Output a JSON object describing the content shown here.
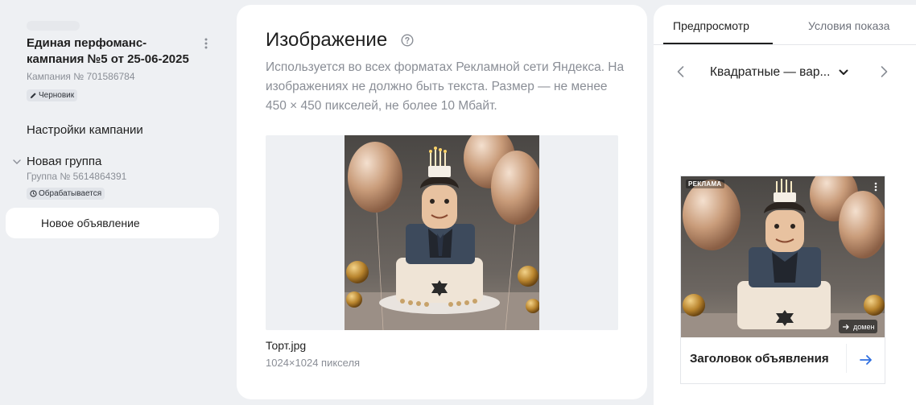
{
  "sidebar": {
    "campaign_title": "Единая перфоманс-кампания №5 от 25-06-2025",
    "campaign_id": "Кампания № 701586784",
    "campaign_status": "Черновик",
    "settings_label": "Настройки кампании",
    "group_title": "Новая группа",
    "group_id": "Группа № 5614864391",
    "group_status": "Обрабатывается",
    "ad_label": "Новое объявление"
  },
  "main": {
    "title": "Изображение",
    "description": "Используется во всех форматах Рекламной сети Яндекса. На изображениях не должно быть текста. Размер — не менее 450 × 450 пикселей, не более 10 Мбайт.",
    "file_name": "Торт.jpg",
    "file_dims": "1024×1024 пикселя"
  },
  "preview": {
    "tabs": [
      {
        "label": "Предпросмотр",
        "active": true
      },
      {
        "label": "Условия показа",
        "active": false
      }
    ],
    "format_selected": "Квадратные — вар...",
    "ad_badge": "РЕКЛАМА",
    "ad_domain": "домен",
    "ad_headline": "Заголовок объявления"
  },
  "colors": {
    "accent": "#2f6fe0",
    "page_bg": "#eef0f3",
    "muted_text": "#8a8e96"
  },
  "icons": {
    "help": "help-circle-icon",
    "menu": "vertical-dots-icon",
    "draft": "pencil-icon",
    "processing": "clock-icon",
    "chevron": "chevron-down-icon",
    "prev": "chevron-left-icon",
    "next": "chevron-right-icon",
    "arrow": "arrow-right-icon"
  }
}
